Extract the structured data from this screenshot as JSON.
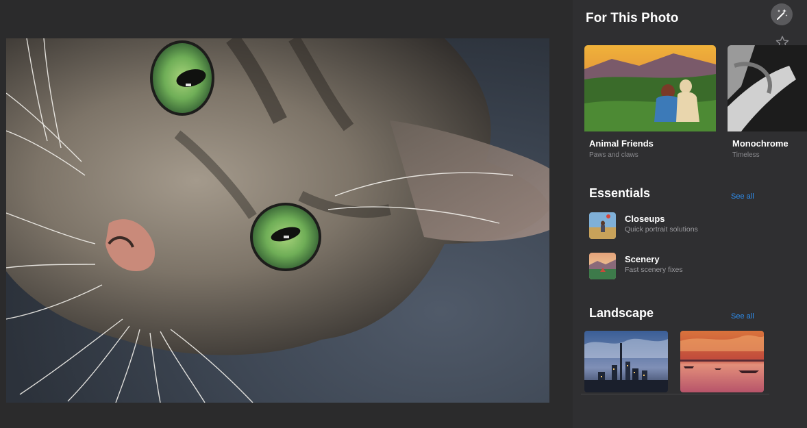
{
  "panel": {
    "title": "For This Photo"
  },
  "toolbar": {
    "magic_icon": "magic-wand-icon",
    "favorite_icon": "star-icon"
  },
  "featured": [
    {
      "name": "Animal Friends",
      "subtitle": "Paws and claws"
    },
    {
      "name": "Monochrome",
      "subtitle": "Timeless"
    }
  ],
  "essentials": {
    "title": "Essentials",
    "see_all": "See all",
    "items": [
      {
        "name": "Closeups",
        "subtitle": "Quick portrait solutions"
      },
      {
        "name": "Scenery",
        "subtitle": "Fast scenery fixes"
      }
    ]
  },
  "landscape": {
    "title": "Landscape",
    "see_all": "See all"
  },
  "colors": {
    "background": "#2a2a2b",
    "panel": "#2f2f31",
    "accent": "#2f8ff0",
    "secondary_text": "#8b8b8f"
  }
}
